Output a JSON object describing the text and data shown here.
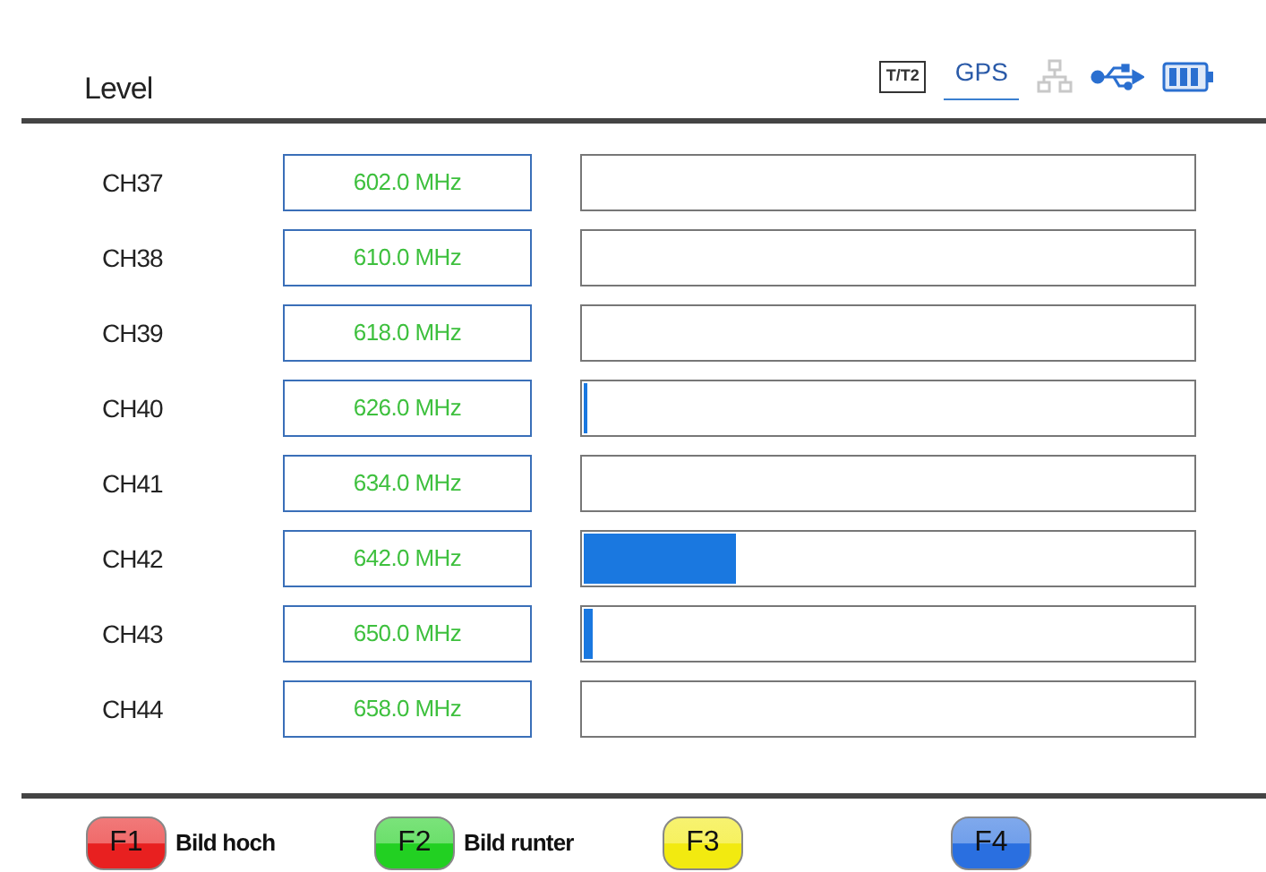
{
  "header": {
    "title": "Level"
  },
  "status_icons": [
    {
      "kind": "standard",
      "label": "T/T2"
    },
    {
      "kind": "gps",
      "label": "GPS",
      "selected": true
    },
    {
      "kind": "network",
      "on": false
    },
    {
      "kind": "usb",
      "on": true
    },
    {
      "kind": "battery"
    }
  ],
  "channels": [
    {
      "name": "CH37",
      "frequency": "602.0 MHz"
    },
    {
      "name": "CH38",
      "frequency": "610.0 MHz"
    },
    {
      "name": "CH39",
      "frequency": "618.0 MHz"
    },
    {
      "name": "CH40",
      "frequency": "626.0 MHz",
      "level": 0.006
    },
    {
      "name": "CH41",
      "frequency": "634.0 MHz"
    },
    {
      "name": "CH42",
      "frequency": "642.0 MHz",
      "level": 0.25
    },
    {
      "name": "CH43",
      "frequency": "650.0 MHz",
      "level": 0.015
    },
    {
      "name": "CH44",
      "frequency": "658.0 MHz"
    }
  ],
  "function_keys": [
    {
      "key": "F1",
      "label": "Bild hoch",
      "color": "#e82020"
    },
    {
      "key": "F2",
      "label": "Bild runter",
      "color": "#22d022"
    },
    {
      "key": "F3",
      "color": "#f2ea10"
    },
    {
      "key": "F4",
      "color": "#2a6fe0"
    }
  ]
}
